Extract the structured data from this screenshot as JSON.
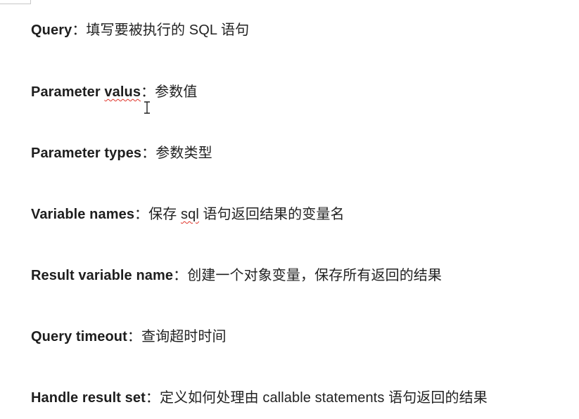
{
  "lines": [
    {
      "term": "Query",
      "sep": "：",
      "desc": "填写要被执行的 SQL 语句"
    },
    {
      "term": "Parameter ",
      "term_flagged": "valus",
      "sep": "：",
      "desc": "参数值"
    },
    {
      "term": "Parameter types",
      "sep": "：",
      "desc": "参数类型"
    },
    {
      "term": "Variable names",
      "sep": "：",
      "desc_pre": "保存 ",
      "desc_flagged": "sql",
      "desc": " 语句返回结果的变量名"
    },
    {
      "term": "Result variable name",
      "sep": "：",
      "desc": "创建一个对象变量，保存所有返回的结果"
    },
    {
      "term": "Query timeout",
      "sep": "：",
      "desc": "查询超时时间"
    },
    {
      "term": "Handle result set",
      "sep": "：",
      "desc": "定义如何处理由 callable statements 语句返回的结果"
    }
  ],
  "colors": {
    "text": "#222222",
    "spellcheck_underline": "#e0352b"
  },
  "icons": {
    "cursor": "text-cursor-ibeam-icon"
  }
}
